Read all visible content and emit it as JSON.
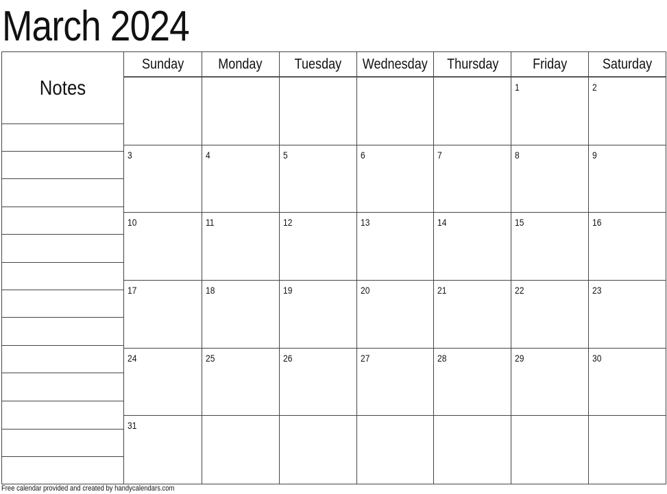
{
  "title": "March 2024",
  "notes_label": "Notes",
  "note_lines": 13,
  "weekdays": [
    "Sunday",
    "Monday",
    "Tuesday",
    "Wednesday",
    "Thursday",
    "Friday",
    "Saturday"
  ],
  "weeks": [
    [
      "",
      "",
      "",
      "",
      "",
      "1",
      "2"
    ],
    [
      "3",
      "4",
      "5",
      "6",
      "7",
      "8",
      "9"
    ],
    [
      "10",
      "11",
      "12",
      "13",
      "14",
      "15",
      "16"
    ],
    [
      "17",
      "18",
      "19",
      "20",
      "21",
      "22",
      "23"
    ],
    [
      "24",
      "25",
      "26",
      "27",
      "28",
      "29",
      "30"
    ],
    [
      "31",
      "",
      "",
      "",
      "",
      "",
      ""
    ]
  ],
  "footer": "Free calendar provided and created by handycalendars.com"
}
